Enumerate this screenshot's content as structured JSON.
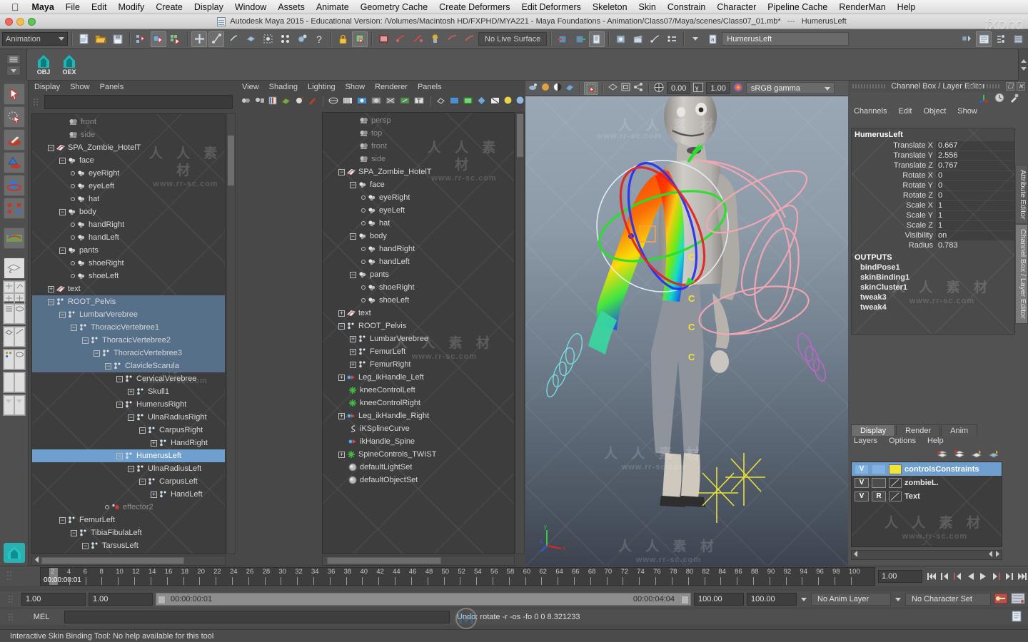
{
  "macmenu": {
    "apple_icon": "apple-icon",
    "items": [
      "Maya",
      "File",
      "Edit",
      "Modify",
      "Create",
      "Display",
      "Window",
      "Assets",
      "Animate",
      "Geometry Cache",
      "Create Deformers",
      "Edit Deformers",
      "Skeleton",
      "Skin",
      "Constrain",
      "Character",
      "Pipeline Cache",
      "RenderMan",
      "Help"
    ]
  },
  "titlebar": {
    "title": "Autodesk Maya 2015 - Educational Version: /Volumes/Macintosh HD/FXPHD/MYA221 - Maya Foundations - Animation/Class07/Maya/scenes/Class07_01.mb*",
    "selected_object": "HumerusLeft",
    "brand": "fxphd"
  },
  "statusline": {
    "menu_set": "Animation",
    "shelf_label": "Animation",
    "live_surface": "No Live Surface",
    "name_field": "HumerusLeft",
    "icons": [
      "new-scene-icon",
      "open-scene-icon",
      "save-scene-icon",
      "select-by-hierarchy-icon",
      "select-by-object-icon",
      "select-by-component-icon",
      "move-snap-grid-icon",
      "snap-curve-icon",
      "snap-point-icon",
      "snap-view-plane-icon",
      "snap-cv-icon",
      "make-live-icon",
      "construction-history-icon",
      "help-icon",
      "lock-icon",
      "render-current-frame-icon",
      "ipr-render-icon",
      "render-settings-icon",
      "hypershade-icon",
      "render-view-icon",
      "snapshot-icon"
    ]
  },
  "shelf": {
    "buttons": [
      {
        "label": "OBJ",
        "icon": "maya-obj-shelf-icon"
      },
      {
        "label": "OEX",
        "icon": "maya-oex-shelf-icon"
      }
    ]
  },
  "toolbox": {
    "items": [
      "select-tool-icon",
      "lasso-select-tool-icon",
      "paint-select-tool-icon",
      "move-tool-icon",
      "rotate-tool-icon",
      "scale-tool-icon",
      "last-tool-icon",
      "single-perspective-view-icon",
      "four-view-icon",
      "outliner-persp-view-icon",
      "persp-graph-view-icon",
      "hypershade-persp-view-icon",
      "two-pane-split-icon",
      "saved-layouts-icon",
      "maya-logo-icon"
    ]
  },
  "outliner_left": {
    "menus": [
      "Display",
      "Show",
      "Panels"
    ],
    "search_value": "",
    "rows": [
      {
        "indent": 2,
        "toggle": "",
        "icon": "camera-icon",
        "label": "front",
        "dim": true
      },
      {
        "indent": 2,
        "toggle": "",
        "icon": "camera-icon",
        "label": "side",
        "dim": true
      },
      {
        "indent": 1,
        "toggle": "minus",
        "icon": "group-icon",
        "label": "SPA_Zombie_HotelT"
      },
      {
        "indent": 2,
        "toggle": "minus",
        "icon": "mesh-icon",
        "label": "face"
      },
      {
        "indent": 3,
        "toggle": "dot",
        "icon": "mesh-icon",
        "label": "eyeRight"
      },
      {
        "indent": 3,
        "toggle": "dot",
        "icon": "mesh-icon",
        "label": "eyeLeft"
      },
      {
        "indent": 3,
        "toggle": "dot",
        "icon": "mesh-icon",
        "label": "hat"
      },
      {
        "indent": 2,
        "toggle": "minus",
        "icon": "mesh-icon",
        "label": "body"
      },
      {
        "indent": 3,
        "toggle": "dot",
        "icon": "mesh-icon",
        "label": "handRight"
      },
      {
        "indent": 3,
        "toggle": "dot",
        "icon": "mesh-icon",
        "label": "handLeft"
      },
      {
        "indent": 2,
        "toggle": "minus",
        "icon": "mesh-icon",
        "label": "pants"
      },
      {
        "indent": 3,
        "toggle": "dot",
        "icon": "mesh-icon",
        "label": "shoeRight"
      },
      {
        "indent": 3,
        "toggle": "dot",
        "icon": "mesh-icon",
        "label": "shoeLeft"
      },
      {
        "indent": 1,
        "toggle": "plus",
        "icon": "group-icon",
        "label": "text"
      },
      {
        "indent": 1,
        "toggle": "minus",
        "icon": "joint-icon",
        "label": "ROOT_Pelvis",
        "band": true
      },
      {
        "indent": 2,
        "toggle": "minus",
        "icon": "joint-icon",
        "label": "LumbarVerebree",
        "band": true
      },
      {
        "indent": 3,
        "toggle": "minus",
        "icon": "joint-icon",
        "label": "ThoracicVertebree1",
        "band": true
      },
      {
        "indent": 4,
        "toggle": "minus",
        "icon": "joint-icon",
        "label": "ThoracicVertebree2",
        "band": true
      },
      {
        "indent": 5,
        "toggle": "minus",
        "icon": "joint-icon",
        "label": "ThoracicVertebree3",
        "band": true
      },
      {
        "indent": 6,
        "toggle": "minus",
        "icon": "joint-icon",
        "label": "ClavicleScarula",
        "band": true
      },
      {
        "indent": 7,
        "toggle": "minus",
        "icon": "joint-icon",
        "label": "CervicalVerebree"
      },
      {
        "indent": 8,
        "toggle": "plus",
        "icon": "joint-icon",
        "label": "Skull1"
      },
      {
        "indent": 7,
        "toggle": "minus",
        "icon": "joint-icon",
        "label": "HumerusRight"
      },
      {
        "indent": 8,
        "toggle": "minus",
        "icon": "joint-icon",
        "label": "UlnaRadiusRight"
      },
      {
        "indent": 9,
        "toggle": "minus",
        "icon": "joint-icon",
        "label": "CarpusRight"
      },
      {
        "indent": 10,
        "toggle": "plus",
        "icon": "joint-icon",
        "label": "HandRight"
      },
      {
        "indent": 7,
        "toggle": "minus",
        "icon": "joint-icon",
        "label": "HumerusLeft",
        "selected": true
      },
      {
        "indent": 8,
        "toggle": "minus",
        "icon": "joint-icon",
        "label": "UlnaRadiusLeft"
      },
      {
        "indent": 9,
        "toggle": "minus",
        "icon": "joint-icon",
        "label": "CarpusLeft"
      },
      {
        "indent": 10,
        "toggle": "plus",
        "icon": "joint-icon",
        "label": "HandLeft"
      },
      {
        "indent": 6,
        "toggle": "dot",
        "icon": "effector-icon",
        "label": "effector2",
        "dim": true
      },
      {
        "indent": 2,
        "toggle": "minus",
        "icon": "joint-icon",
        "label": "FemurLeft"
      },
      {
        "indent": 3,
        "toggle": "minus",
        "icon": "joint-icon",
        "label": "TibiaFibulaLeft"
      },
      {
        "indent": 4,
        "toggle": "minus",
        "icon": "joint-icon",
        "label": "TarsusLeft"
      }
    ]
  },
  "outliner_mid": {
    "menus": [
      "View",
      "Shading",
      "Lighting",
      "Show",
      "Renderer",
      "Panels"
    ],
    "rows": [
      {
        "indent": 2,
        "toggle": "",
        "icon": "camera-icon",
        "label": "persp",
        "dim": true
      },
      {
        "indent": 2,
        "toggle": "",
        "icon": "camera-icon",
        "label": "top",
        "dim": true
      },
      {
        "indent": 2,
        "toggle": "",
        "icon": "camera-icon",
        "label": "front",
        "dim": true
      },
      {
        "indent": 2,
        "toggle": "",
        "icon": "camera-icon",
        "label": "side",
        "dim": true
      },
      {
        "indent": 1,
        "toggle": "minus",
        "icon": "group-icon",
        "label": "SPA_Zombie_HotelT"
      },
      {
        "indent": 2,
        "toggle": "minus",
        "icon": "mesh-icon",
        "label": "face"
      },
      {
        "indent": 3,
        "toggle": "dot",
        "icon": "mesh-icon",
        "label": "eyeRight"
      },
      {
        "indent": 3,
        "toggle": "dot",
        "icon": "mesh-icon",
        "label": "eyeLeft"
      },
      {
        "indent": 3,
        "toggle": "dot",
        "icon": "mesh-icon",
        "label": "hat"
      },
      {
        "indent": 2,
        "toggle": "minus",
        "icon": "mesh-icon",
        "label": "body"
      },
      {
        "indent": 3,
        "toggle": "dot",
        "icon": "mesh-icon",
        "label": "handRight"
      },
      {
        "indent": 3,
        "toggle": "dot",
        "icon": "mesh-icon",
        "label": "handLeft"
      },
      {
        "indent": 2,
        "toggle": "minus",
        "icon": "mesh-icon",
        "label": "pants"
      },
      {
        "indent": 3,
        "toggle": "dot",
        "icon": "mesh-icon",
        "label": "shoeRight"
      },
      {
        "indent": 3,
        "toggle": "dot",
        "icon": "mesh-icon",
        "label": "shoeLeft"
      },
      {
        "indent": 1,
        "toggle": "plus",
        "icon": "group-icon",
        "label": "text"
      },
      {
        "indent": 1,
        "toggle": "minus",
        "icon": "joint-icon",
        "label": "ROOT_Pelvis"
      },
      {
        "indent": 2,
        "toggle": "plus",
        "icon": "joint-icon",
        "label": "LumbarVerebree"
      },
      {
        "indent": 2,
        "toggle": "plus",
        "icon": "joint-icon",
        "label": "FemurLeft"
      },
      {
        "indent": 2,
        "toggle": "plus",
        "icon": "joint-icon",
        "label": "FemurRight"
      },
      {
        "indent": 1,
        "toggle": "plus",
        "icon": "ikhandle-icon",
        "label": "Leg_ikHandle_Left"
      },
      {
        "indent": 1,
        "toggle": "",
        "icon": "locator-icon",
        "label": "kneeControlLeft"
      },
      {
        "indent": 1,
        "toggle": "",
        "icon": "locator-icon",
        "label": "kneeControlRight"
      },
      {
        "indent": 1,
        "toggle": "plus",
        "icon": "ikhandle-icon",
        "label": "Leg_ikHandle_Right"
      },
      {
        "indent": 1,
        "toggle": "",
        "icon": "curve-icon",
        "label": "iKSplineCurve"
      },
      {
        "indent": 1,
        "toggle": "",
        "icon": "ikhandle-icon",
        "label": "ikHandle_Spine"
      },
      {
        "indent": 1,
        "toggle": "plus",
        "icon": "locator-icon",
        "label": "SpineControls_TWIST"
      },
      {
        "indent": 1,
        "toggle": "",
        "icon": "set-icon",
        "label": "defaultLightSet"
      },
      {
        "indent": 1,
        "toggle": "",
        "icon": "set-icon",
        "label": "defaultObjectSet"
      }
    ]
  },
  "viewport": {
    "exposure": "0.00",
    "gamma": "1.00",
    "color_space": "sRGB gamma",
    "axis_labels": {
      "x": "x",
      "y": "y",
      "z": "z"
    },
    "icons": [
      "select-camera-icon",
      "camera-attributes-icon",
      "bookmark-icon",
      "image-plane-icon",
      "two-sided-lighting-icon",
      "grid-icon",
      "wireframe-icon",
      "smooth-shade-icon",
      "flat-shade-icon",
      "shaded-textured-icon",
      "wireframe-on-shaded-icon",
      "xray-icon",
      "xray-joints-icon",
      "xray-active-icon",
      "lighting-default-icon",
      "lighting-all-icon",
      "shadows-icon",
      "ao-icon",
      "motion-blur-icon",
      "multisample-icon",
      "isolate-select-icon",
      "exposure-icon",
      "gamma-icon",
      "color-management-icon"
    ],
    "controls_label": "C"
  },
  "channelbox": {
    "title": "Channel Box / Layer Editor",
    "menus": [
      "Channels",
      "Edit",
      "Object",
      "Show"
    ],
    "object_name": "HumerusLeft",
    "attributes": [
      {
        "name": "Translate X",
        "value": "0.667"
      },
      {
        "name": "Translate Y",
        "value": "2.556"
      },
      {
        "name": "Translate Z",
        "value": "0.767"
      },
      {
        "name": "Rotate X",
        "value": "0"
      },
      {
        "name": "Rotate Y",
        "value": "0"
      },
      {
        "name": "Rotate Z",
        "value": "0"
      },
      {
        "name": "Scale X",
        "value": "1"
      },
      {
        "name": "Scale Y",
        "value": "1"
      },
      {
        "name": "Scale Z",
        "value": "1"
      },
      {
        "name": "Visibility",
        "value": "on"
      },
      {
        "name": "Radius",
        "value": "0.783"
      }
    ],
    "outputs_header": "OUTPUTS",
    "outputs": [
      "bindPose1",
      "skinBinding1",
      "skinCluster1",
      "tweak3",
      "tweak4"
    ],
    "header_icons": [
      "manipulator-icon",
      "clock-icon",
      "eyedropper-icon"
    ],
    "window_buttons": [
      "restore-icon",
      "close-icon"
    ]
  },
  "vtabs": [
    {
      "label": "Attribute Editor",
      "selected": false
    },
    {
      "label": "Channel Box / Layer Editor",
      "selected": true
    }
  ],
  "layer_editor": {
    "tabs": [
      {
        "label": "Display",
        "selected": true
      },
      {
        "label": "Render",
        "selected": false
      },
      {
        "label": "Anim",
        "selected": false
      }
    ],
    "menus": [
      "Layers",
      "Options",
      "Help"
    ],
    "toolbar_icons": [
      "new-layer-icon",
      "new-layer-from-selected-icon",
      "layer-up-icon",
      "layer-down-icon"
    ],
    "layers": [
      {
        "visibility": "V",
        "mode": "",
        "swatch_color": "#f2e33a",
        "name": "controlsConstraints",
        "selected": true
      },
      {
        "visibility": "V",
        "mode": "",
        "swatch_color": "",
        "name": "zombieL.",
        "selected": false
      },
      {
        "visibility": "V",
        "mode": "R",
        "swatch_color": "",
        "name": "Text",
        "selected": false
      }
    ]
  },
  "timeslider": {
    "current_time_label": "00:00:00:01",
    "current_frame_field": "1.00",
    "ticks": [
      2,
      4,
      6,
      8,
      10,
      12,
      14,
      16,
      18,
      20,
      22,
      24,
      26,
      28,
      30,
      32,
      34,
      36,
      38,
      40,
      42,
      44,
      46,
      48,
      50,
      52,
      54,
      56,
      58,
      60,
      62,
      64,
      66,
      68,
      70,
      72,
      74,
      76,
      78,
      80,
      82,
      84,
      86,
      88,
      90,
      92,
      94,
      96,
      98,
      100
    ],
    "playback_icons": [
      "go-to-start-icon",
      "step-back-keyframe-icon",
      "step-back-frame-icon",
      "play-backwards-icon",
      "play-forwards-icon",
      "step-forward-frame-icon",
      "step-forward-keyframe-icon",
      "go-to-end-icon"
    ]
  },
  "rangeslider": {
    "anim_start": "1.00",
    "range_start": "1.00",
    "range_current": "00:00:00:01",
    "range_end_label": "00:00:04:04",
    "playback_end": "100.00",
    "anim_end": "100.00",
    "anim_layer": "No Anim Layer",
    "character_set": "No Character Set",
    "right_icons": [
      "auto-key-icon",
      "animation-preferences-icon"
    ]
  },
  "commandline": {
    "language": "MEL",
    "input_value": "",
    "result": "Undo: rotate -r -os -fo 0 0 8.321233"
  },
  "helpline": {
    "text": "Interactive Skin Binding Tool: No help available for this tool"
  },
  "watermark": {
    "cn": "人 人 素 材",
    "url": "www.rr-sc.com"
  }
}
